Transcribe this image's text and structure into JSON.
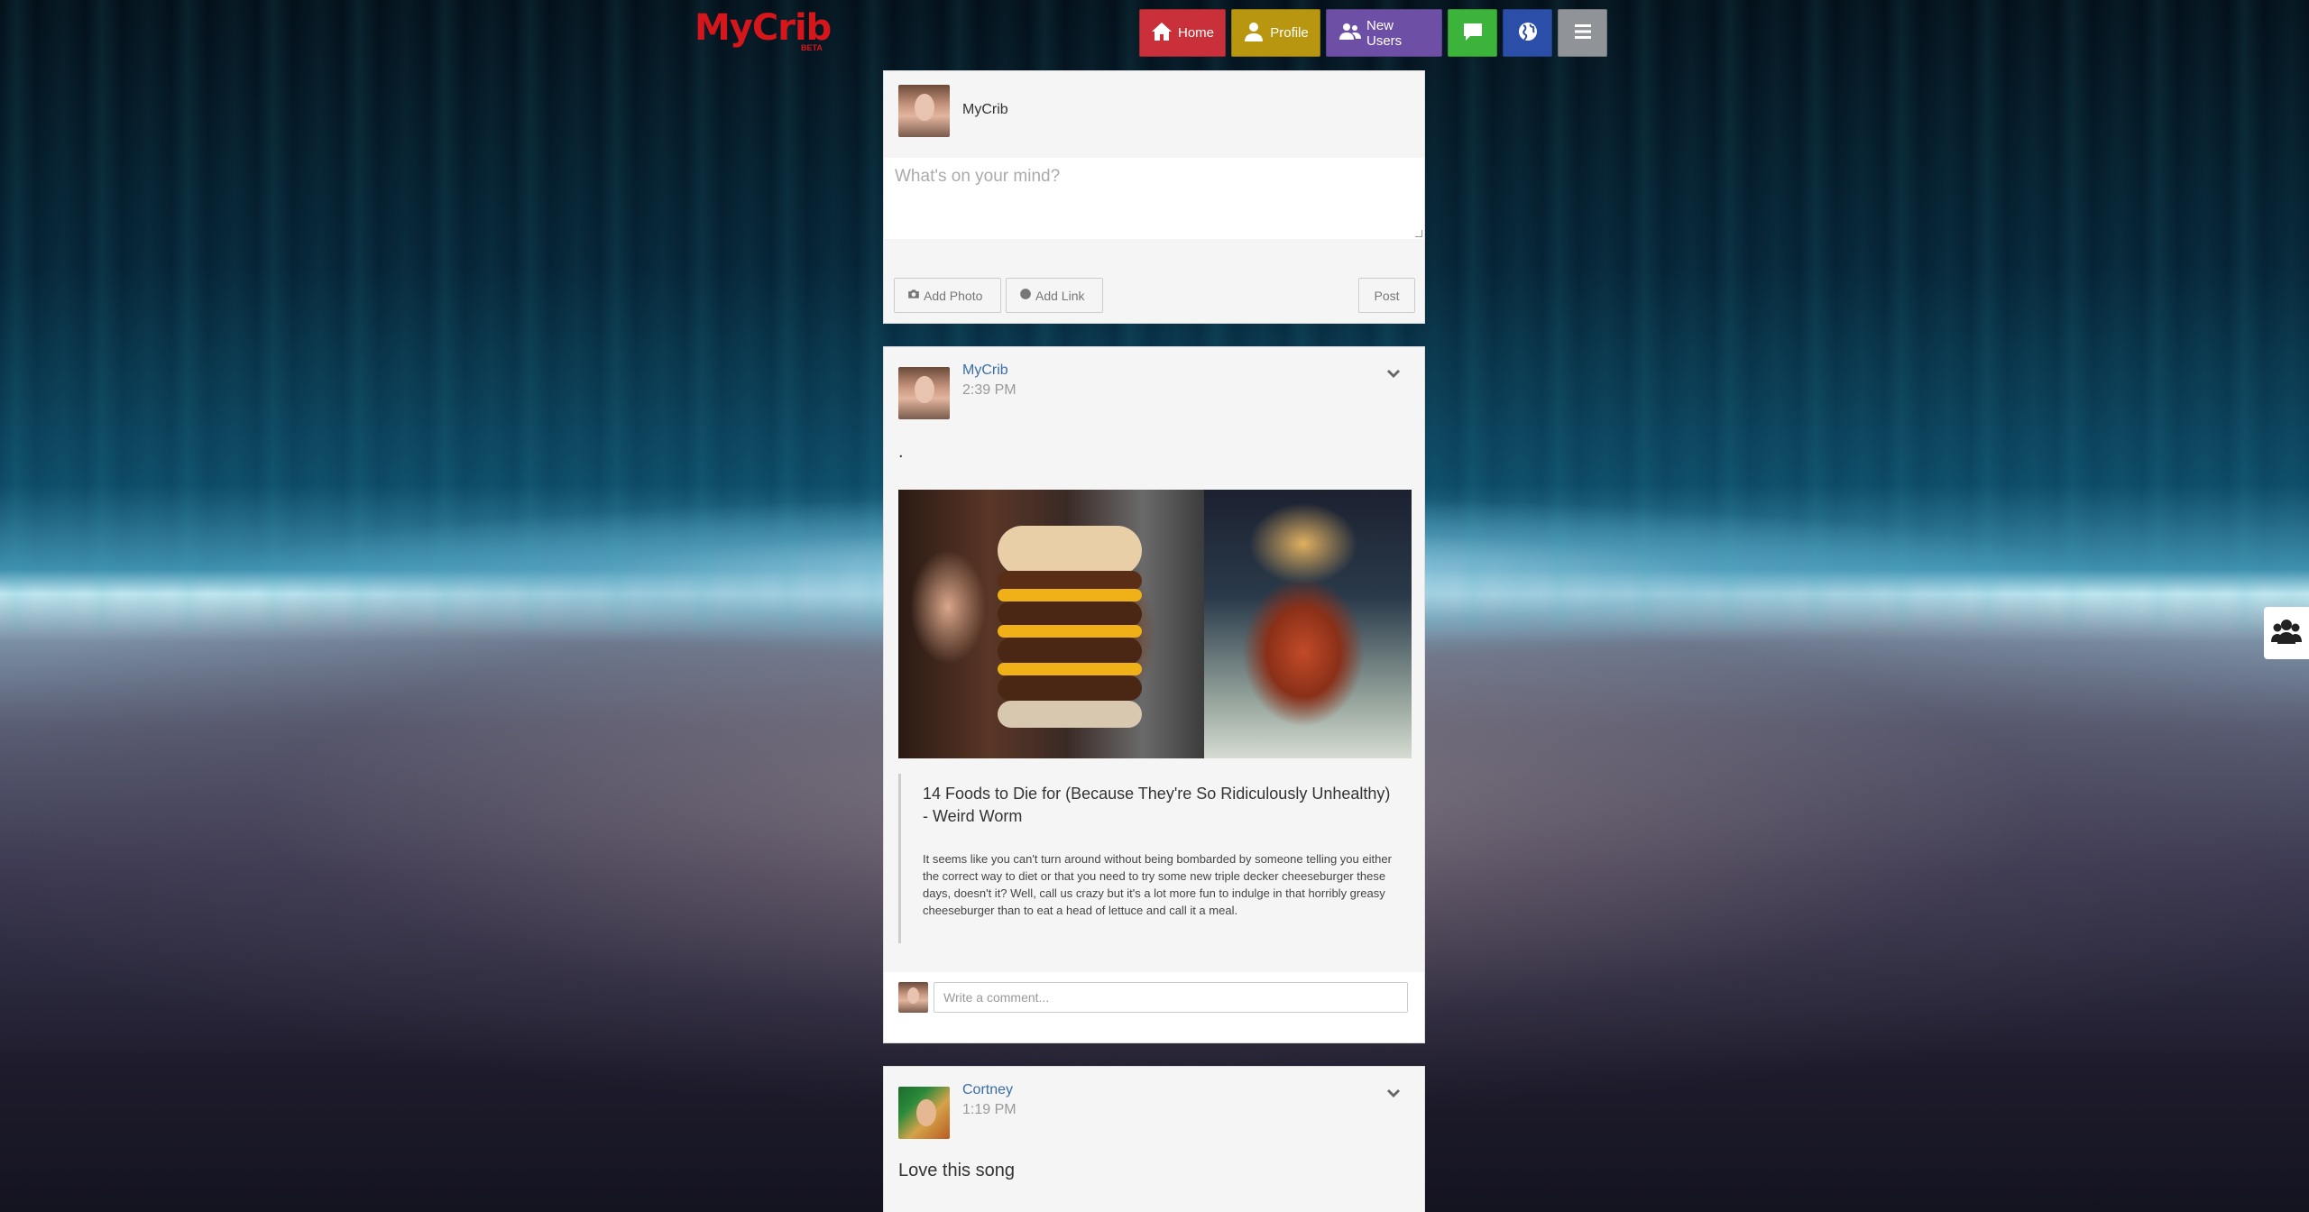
{
  "header": {
    "logo": "MyCrib",
    "logo_badge": "BETA",
    "nav": [
      {
        "label": "Home",
        "icon": "home-icon",
        "color": "#c9303a"
      },
      {
        "label": "Profile",
        "icon": "user-icon",
        "color": "#b8960f"
      },
      {
        "label": "New Users",
        "icon": "users-icon",
        "color": "#6d50a6"
      },
      {
        "label": "",
        "icon": "chat-icon",
        "color": "#3cb43c"
      },
      {
        "label": "",
        "icon": "globe-icon",
        "color": "#2b4fa8"
      },
      {
        "label": "",
        "icon": "menu-icon",
        "color": "#909498"
      }
    ]
  },
  "composer": {
    "user_name": "MyCrib",
    "placeholder": "What's on your mind?",
    "add_photo": "Add Photo",
    "add_link": "Add Link",
    "post": "Post"
  },
  "posts": [
    {
      "author": "MyCrib",
      "time": "2:39 PM",
      "text": ".",
      "link_title": "14 Foods to Die for (Because They're So Ridiculously Unhealthy) - Weird Worm",
      "link_description": "It seems like you can't turn around without being bombarded by someone telling you either the correct way to diet or that you need to try some new triple decker cheeseburger these days, doesn't it? Well, call us crazy but it's a lot more fun to indulge in that horribly greasy cheeseburger than to eat a head of lettuce and call it a meal.",
      "comment_placeholder": "Write a comment..."
    },
    {
      "author": "Cortney",
      "time": "1:19 PM",
      "text": "Love this song"
    }
  ]
}
